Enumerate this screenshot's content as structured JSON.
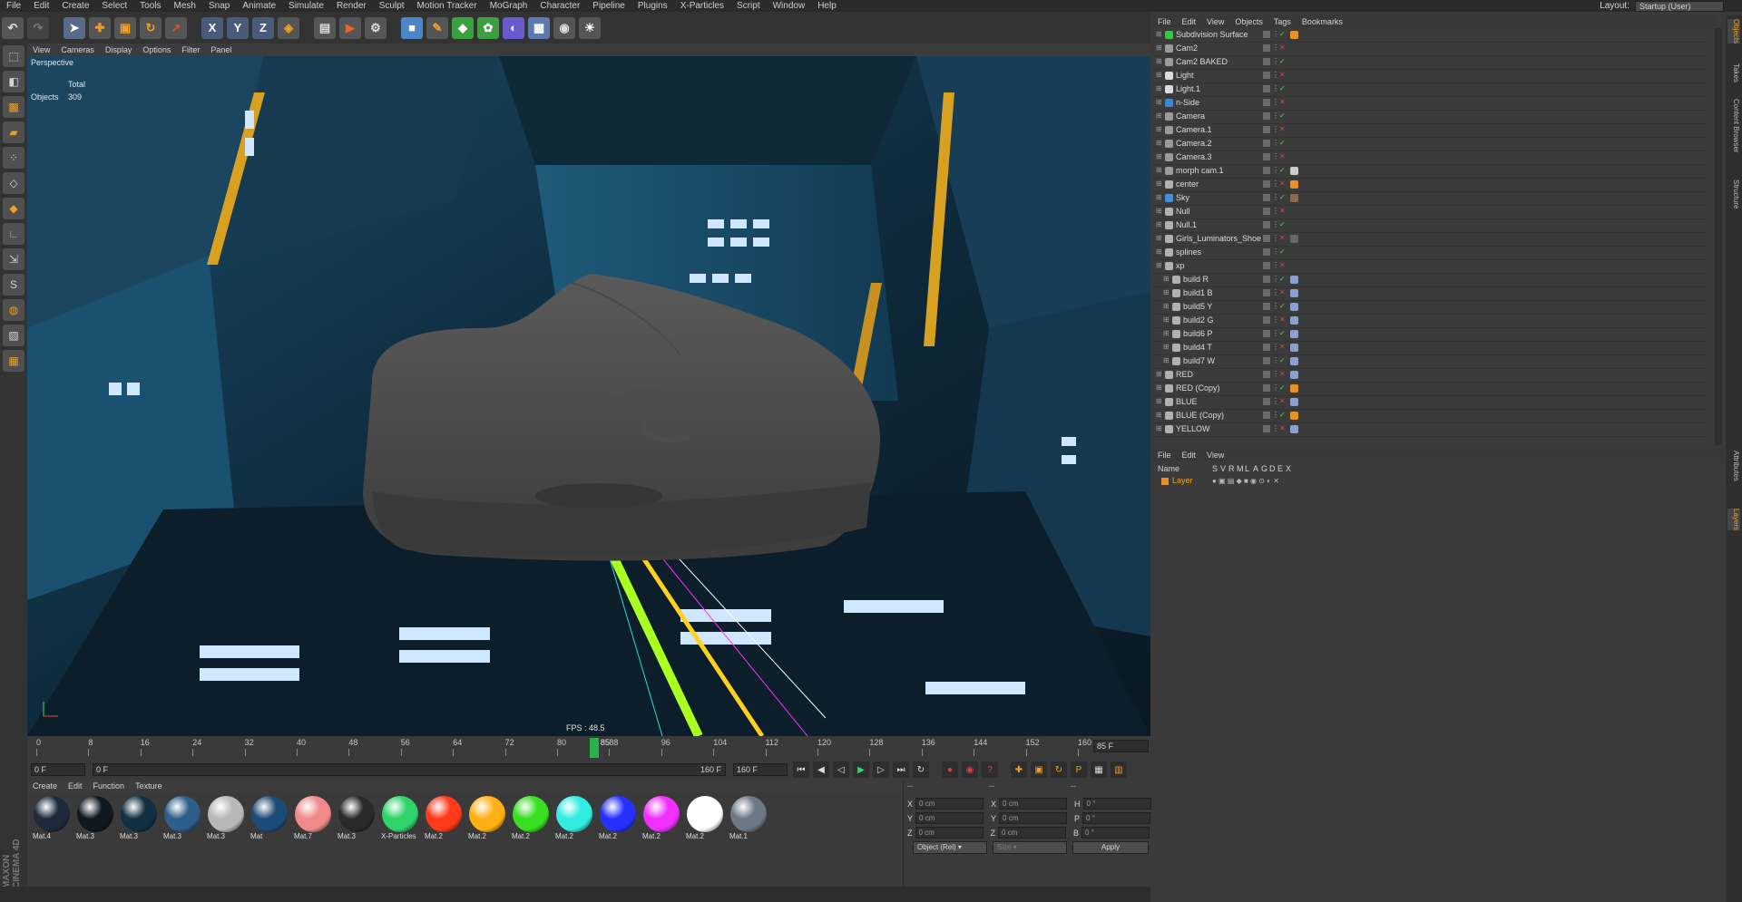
{
  "menubar": [
    "File",
    "Edit",
    "Create",
    "Select",
    "Tools",
    "Mesh",
    "Snap",
    "Animate",
    "Simulate",
    "Render",
    "Sculpt",
    "Motion Tracker",
    "MoGraph",
    "Character",
    "Pipeline",
    "Plugins",
    "X-Particles",
    "Script",
    "Window",
    "Help"
  ],
  "layout": {
    "label": "Layout:",
    "value": "Startup (User)"
  },
  "viewport": {
    "menu": [
      "View",
      "Cameras",
      "Display",
      "Options",
      "Filter",
      "Panel"
    ],
    "mode": "Perspective",
    "stats": {
      "total_label": "Total",
      "objects_label": "Objects",
      "objects_value": "309"
    },
    "fps": "FPS : 48.5"
  },
  "timeline": {
    "ticks": [
      "0",
      "8",
      "16",
      "24",
      "32",
      "40",
      "48",
      "56",
      "64",
      "72",
      "80",
      "88",
      "96",
      "104",
      "112",
      "120",
      "128",
      "136",
      "144",
      "152",
      "160"
    ],
    "current": 85,
    "current_label": "85",
    "end_label": "85 F",
    "max": 160
  },
  "transport": {
    "start": "0 F",
    "range_start": "0 F",
    "range_end": "160 F",
    "end": "160 F"
  },
  "material_manager": {
    "menu": [
      "Create",
      "Edit",
      "Function",
      "Texture"
    ],
    "materials": [
      {
        "label": "Mat.4",
        "color": "#1e2a3c"
      },
      {
        "label": "Mat.3",
        "color": "#101820"
      },
      {
        "label": "Mat.3",
        "color": "#123044"
      },
      {
        "label": "Mat.3",
        "color": "#2d5e8c"
      },
      {
        "label": "Mat.3",
        "color": "#b8b8b8"
      },
      {
        "label": "Mat",
        "color": "#1e4c78"
      },
      {
        "label": "Mat.7",
        "color": "#f08a8a"
      },
      {
        "label": "Mat.3",
        "color": "#2a2a2a"
      },
      {
        "label": "X-Particles",
        "color": "#2fd46a"
      },
      {
        "label": "Mat.2",
        "color": "#ff3b1a"
      },
      {
        "label": "Mat.2",
        "color": "#ffb015"
      },
      {
        "label": "Mat.2",
        "color": "#38e020"
      },
      {
        "label": "Mat.2",
        "color": "#30ede0"
      },
      {
        "label": "Mat.2",
        "color": "#2630ff"
      },
      {
        "label": "Mat.2",
        "color": "#f030ff"
      },
      {
        "label": "Mat.2",
        "color": "#ffffff"
      },
      {
        "label": "Mat.1",
        "color": "#6c7884"
      }
    ]
  },
  "coordinates": {
    "col_headers": [
      "--",
      "--",
      "--"
    ],
    "rows": [
      {
        "a": "X",
        "av": "0 cm",
        "b": "X",
        "bv": "0 cm",
        "c": "H",
        "cv": "0 °"
      },
      {
        "a": "Y",
        "av": "0 cm",
        "b": "Y",
        "bv": "0 cm",
        "c": "P",
        "cv": "0 °"
      },
      {
        "a": "Z",
        "av": "0 cm",
        "b": "Z",
        "bv": "0 cm",
        "c": "B",
        "cv": "0 °"
      }
    ],
    "mode": "Object (Rel)",
    "size": "Size",
    "apply": "Apply"
  },
  "object_manager": {
    "menu": [
      "File",
      "Edit",
      "View",
      "Objects",
      "Tags",
      "Bookmarks"
    ],
    "objects": [
      {
        "name": "Subdivision Surface",
        "icon": "#3fc24a",
        "indent": 0,
        "tag": "#e8902a"
      },
      {
        "name": "Cam2",
        "icon": "#9a9a9a",
        "indent": 0,
        "tag": ""
      },
      {
        "name": "Cam2 BAKED",
        "icon": "#9a9a9a",
        "indent": 0,
        "tag": ""
      },
      {
        "name": "Light",
        "icon": "#dcdcdc",
        "indent": 0,
        "tag": ""
      },
      {
        "name": "Light.1",
        "icon": "#dcdcdc",
        "indent": 0,
        "tag": ""
      },
      {
        "name": "n-Side",
        "icon": "#3a86d8",
        "indent": 0,
        "tag": ""
      },
      {
        "name": "Camera",
        "icon": "#9a9a9a",
        "indent": 0,
        "tag": ""
      },
      {
        "name": "Camera.1",
        "icon": "#9a9a9a",
        "indent": 0,
        "tag": ""
      },
      {
        "name": "Camera.2",
        "icon": "#9a9a9a",
        "indent": 0,
        "tag": ""
      },
      {
        "name": "Camera.3",
        "icon": "#9a9a9a",
        "indent": 0,
        "tag": ""
      },
      {
        "name": "morph cam.1",
        "icon": "#9a9a9a",
        "indent": 0,
        "tag": "#cccccc"
      },
      {
        "name": "center",
        "icon": "#b0b0b0",
        "indent": 0,
        "tag": "#e8902a"
      },
      {
        "name": "Sky",
        "icon": "#4a8ed8",
        "indent": 0,
        "tag": "#8a6a50"
      },
      {
        "name": "Null",
        "icon": "#b0b0b0",
        "indent": 0,
        "tag": ""
      },
      {
        "name": "Null.1",
        "icon": "#b0b0b0",
        "indent": 0,
        "tag": ""
      },
      {
        "name": "Girls_Luminators_Shoe",
        "icon": "#b0b0b0",
        "indent": 0,
        "tag": "#666666"
      },
      {
        "name": "splines",
        "icon": "#b0b0b0",
        "indent": 0,
        "tag": ""
      },
      {
        "name": "xp",
        "icon": "#b0b0b0",
        "indent": 0,
        "tag": ""
      },
      {
        "name": "build R",
        "icon": "#b0b0b0",
        "indent": 1,
        "tag": "#8aa0d0"
      },
      {
        "name": "build1  B",
        "icon": "#b0b0b0",
        "indent": 1,
        "tag": "#8aa0d0"
      },
      {
        "name": "build5 Y",
        "icon": "#b0b0b0",
        "indent": 1,
        "tag": "#8aa0d0"
      },
      {
        "name": "build2 G",
        "icon": "#b0b0b0",
        "indent": 1,
        "tag": "#8aa0d0"
      },
      {
        "name": "build6 P",
        "icon": "#b0b0b0",
        "indent": 1,
        "tag": "#8aa0d0"
      },
      {
        "name": "build4 T",
        "icon": "#b0b0b0",
        "indent": 1,
        "tag": "#8aa0d0"
      },
      {
        "name": "build7 W",
        "icon": "#b0b0b0",
        "indent": 1,
        "tag": "#8aa0d0"
      },
      {
        "name": "RED",
        "icon": "#b0b0b0",
        "indent": 0,
        "tag": "#8aa0d0"
      },
      {
        "name": "RED (Copy)",
        "icon": "#b0b0b0",
        "indent": 0,
        "tag": "#e8902a"
      },
      {
        "name": "BLUE",
        "icon": "#b0b0b0",
        "indent": 0,
        "tag": "#8aa0d0"
      },
      {
        "name": "BLUE (Copy)",
        "icon": "#b0b0b0",
        "indent": 0,
        "tag": "#e8902a"
      },
      {
        "name": "YELLOW",
        "icon": "#b0b0b0",
        "indent": 0,
        "tag": "#8aa0d0"
      }
    ]
  },
  "layer_manager": {
    "menu": [
      "File",
      "Edit",
      "View"
    ],
    "name_header": "Name",
    "columns": [
      "S",
      "V",
      "R",
      "M",
      "L",
      "A",
      "G",
      "D",
      "E",
      "X"
    ],
    "layer": "Layer"
  },
  "right_tabs": [
    "Objects",
    "Takes",
    "Content Browser",
    "Structure",
    "Attributes",
    "Layers"
  ],
  "branding": "MAXON CINEMA 4D"
}
